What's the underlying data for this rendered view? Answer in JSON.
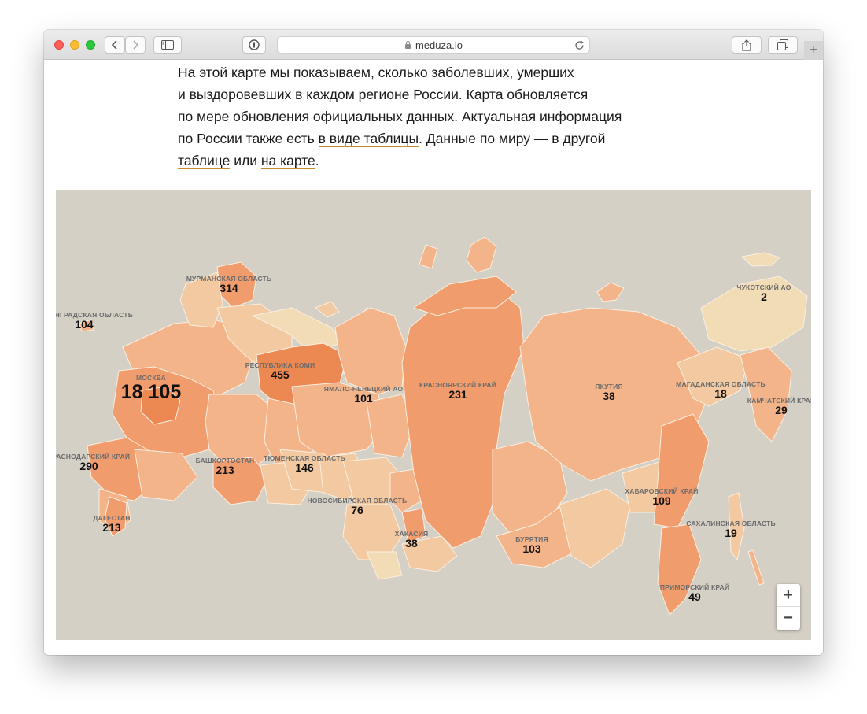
{
  "browser": {
    "url": "meduza.io"
  },
  "intro": {
    "line1": "На этой карте мы показываем, сколько заболевших, умерших",
    "line2": "и выздоровевших в каждом регионе России. Карта обновляется",
    "line3": "по мере обновления официальных данных. Актуальная информация",
    "line4_a": "по России также есть ",
    "link_table": "в виде таблицы",
    "line4_b": ". Данные по миру — в другой",
    "link_world_table": "таблице",
    "line5_mid": " или ",
    "link_world_map": "на карте",
    "line5_end": "."
  },
  "map": {
    "colors": {
      "sea": "#d4d0c6",
      "light": "#f1dcb6",
      "pale": "#f2c9a0",
      "mid": "#f3b48a",
      "strong": "#f19c6c",
      "dark": "#ec8852"
    },
    "regions": [
      {
        "id": "murmansk",
        "name": "МУРМАНСКАЯ ОБЛАСТЬ",
        "value": "314"
      },
      {
        "id": "leningrad",
        "name": "ЛЕНИНГРАДСКАЯ ОБЛАСТЬ",
        "value": "104"
      },
      {
        "id": "moscow",
        "name": "МОСКВА",
        "value": "18 105"
      },
      {
        "id": "komi",
        "name": "РЕСПУБЛИКА КОМИ",
        "value": "455"
      },
      {
        "id": "yamal",
        "name": "ЯМАЛО-НЕНЕЦКИЙ АО",
        "value": "101"
      },
      {
        "id": "krasnoyarsk",
        "name": "КРАСНОЯРСКИЙ КРАЙ",
        "value": "231"
      },
      {
        "id": "yakutia",
        "name": "ЯКУТИЯ",
        "value": "38"
      },
      {
        "id": "magadan",
        "name": "МАГАДАНСКАЯ ОБЛАСТЬ",
        "value": "18"
      },
      {
        "id": "chukotka",
        "name": "ЧУКОТСКИЙ АО",
        "value": "2"
      },
      {
        "id": "kamchatka",
        "name": "КАМЧАТСКИЙ КРАЙ",
        "value": "29"
      },
      {
        "id": "krasnodar",
        "name": "КРАСНОДАРСКИЙ КРАЙ",
        "value": "290"
      },
      {
        "id": "bashkortostan",
        "name": "БАШКОРТОСТАН",
        "value": "213"
      },
      {
        "id": "tyumen",
        "name": "ТЮМЕНСКАЯ ОБЛАСТЬ",
        "value": "146"
      },
      {
        "id": "novosibirsk",
        "name": "НОВОСИБИРСКАЯ ОБЛАСТЬ",
        "value": "76"
      },
      {
        "id": "dagestan",
        "name": "ДАГЕСТАН",
        "value": "213"
      },
      {
        "id": "khakassia",
        "name": "ХАКАСИЯ",
        "value": "38"
      },
      {
        "id": "buryatia",
        "name": "БУРЯТИЯ",
        "value": "103"
      },
      {
        "id": "khabarovsk",
        "name": "ХАБАРОВСКИЙ КРАЙ",
        "value": "109"
      },
      {
        "id": "sakhalin",
        "name": "САХАЛИНСКАЯ ОБЛАСТЬ",
        "value": "19"
      },
      {
        "id": "primorsky",
        "name": "ПРИМОРСКИЙ КРАЙ",
        "value": "49"
      }
    ],
    "zoom_in": "+",
    "zoom_out": "−"
  }
}
